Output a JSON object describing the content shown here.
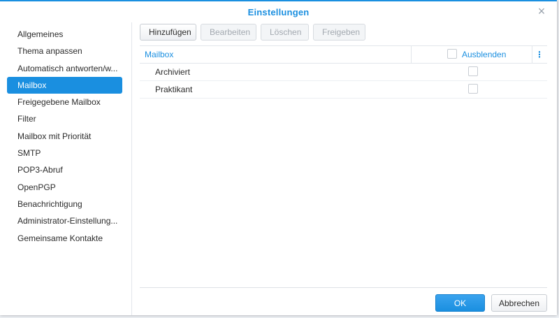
{
  "dialog": {
    "title": "Einstellungen"
  },
  "sidebar": {
    "items": [
      {
        "label": "Allgemeines"
      },
      {
        "label": "Thema anpassen"
      },
      {
        "label": "Automatisch antworten/w..."
      },
      {
        "label": "Mailbox"
      },
      {
        "label": "Freigegebene Mailbox"
      },
      {
        "label": "Filter"
      },
      {
        "label": "Mailbox mit Priorität"
      },
      {
        "label": "SMTP"
      },
      {
        "label": "POP3-Abruf"
      },
      {
        "label": "OpenPGP"
      },
      {
        "label": "Benachrichtigung"
      },
      {
        "label": "Administrator-Einstellung..."
      },
      {
        "label": "Gemeinsame Kontakte"
      }
    ],
    "active_index": 3
  },
  "toolbar": {
    "add_label": "Hinzufügen",
    "edit_label": "Bearbeiten",
    "delete_label": "Löschen",
    "share_label": "Freigeben"
  },
  "table": {
    "columns": {
      "mailbox": "Mailbox",
      "hide": "Ausblenden",
      "menu": "⋮"
    },
    "rows": [
      {
        "name": "Archiviert",
        "hidden": false
      },
      {
        "name": "Praktikant",
        "hidden": false
      }
    ]
  },
  "footer": {
    "ok_label": "OK",
    "cancel_label": "Abbrechen"
  },
  "icons": {
    "close": "close-icon",
    "column_menu": "vertical-dots-icon"
  },
  "colors": {
    "accent": "#1a8fe0"
  }
}
